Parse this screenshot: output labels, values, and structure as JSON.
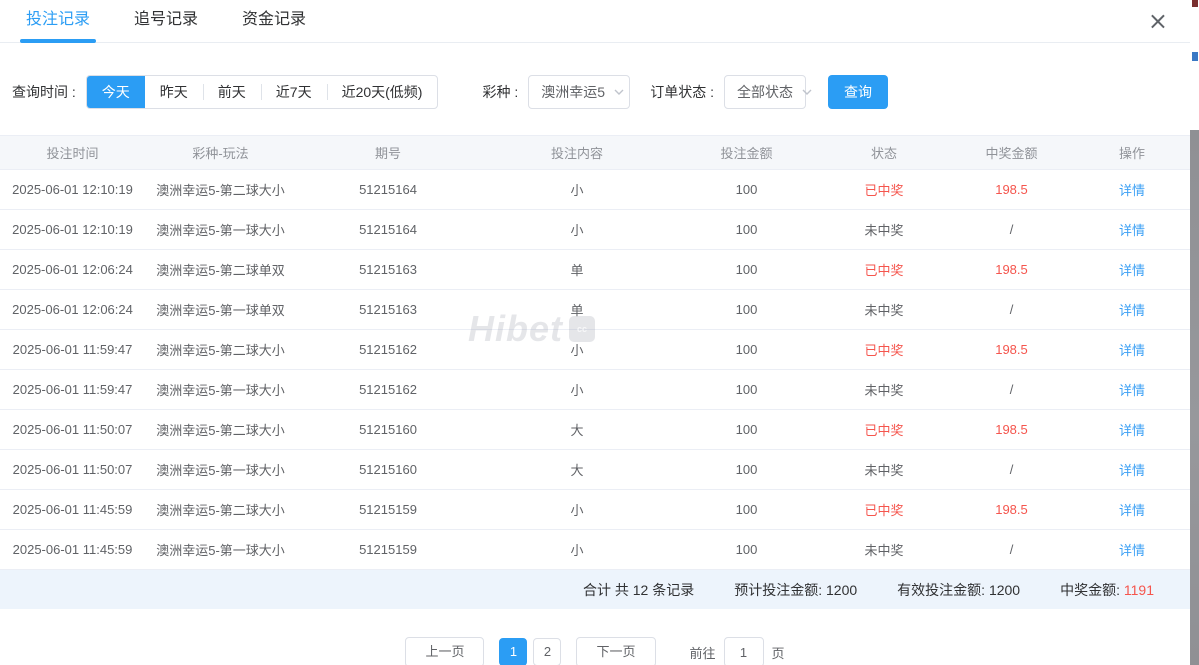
{
  "tabs": {
    "items": [
      {
        "label": "投注记录",
        "active": true
      },
      {
        "label": "追号记录",
        "active": false
      },
      {
        "label": "资金记录",
        "active": false
      }
    ],
    "close_icon": "×"
  },
  "filters": {
    "time_label": "查询时间 :",
    "time_options": [
      "今天",
      "昨天",
      "前天",
      "近7天",
      "近20天(低频)"
    ],
    "time_active": "今天",
    "lottery_label": "彩种 :",
    "lottery_value": "澳洲幸运5",
    "status_label": "订单状态 :",
    "status_value": "全部状态",
    "search_label": "查询"
  },
  "table": {
    "columns": [
      "投注时间",
      "彩种-玩法",
      "期号",
      "投注内容",
      "投注金额",
      "状态",
      "中奖金额",
      "操作"
    ],
    "rows": [
      {
        "time": "2025-06-01 12:10:19",
        "game": "澳洲幸运5-第二球大小",
        "issue": "51215164",
        "content": "小",
        "amount": "100",
        "status": "已中奖",
        "win": "198.5",
        "action": "详情"
      },
      {
        "time": "2025-06-01 12:10:19",
        "game": "澳洲幸运5-第一球大小",
        "issue": "51215164",
        "content": "小",
        "amount": "100",
        "status": "未中奖",
        "win": "/",
        "action": "详情"
      },
      {
        "time": "2025-06-01 12:06:24",
        "game": "澳洲幸运5-第二球单双",
        "issue": "51215163",
        "content": "单",
        "amount": "100",
        "status": "已中奖",
        "win": "198.5",
        "action": "详情"
      },
      {
        "time": "2025-06-01 12:06:24",
        "game": "澳洲幸运5-第一球单双",
        "issue": "51215163",
        "content": "单",
        "amount": "100",
        "status": "未中奖",
        "win": "/",
        "action": "详情"
      },
      {
        "time": "2025-06-01 11:59:47",
        "game": "澳洲幸运5-第二球大小",
        "issue": "51215162",
        "content": "小",
        "amount": "100",
        "status": "已中奖",
        "win": "198.5",
        "action": "详情"
      },
      {
        "time": "2025-06-01 11:59:47",
        "game": "澳洲幸运5-第一球大小",
        "issue": "51215162",
        "content": "小",
        "amount": "100",
        "status": "未中奖",
        "win": "/",
        "action": "详情"
      },
      {
        "time": "2025-06-01 11:50:07",
        "game": "澳洲幸运5-第二球大小",
        "issue": "51215160",
        "content": "大",
        "amount": "100",
        "status": "已中奖",
        "win": "198.5",
        "action": "详情"
      },
      {
        "time": "2025-06-01 11:50:07",
        "game": "澳洲幸运5-第一球大小",
        "issue": "51215160",
        "content": "大",
        "amount": "100",
        "status": "未中奖",
        "win": "/",
        "action": "详情"
      },
      {
        "time": "2025-06-01 11:45:59",
        "game": "澳洲幸运5-第二球大小",
        "issue": "51215159",
        "content": "小",
        "amount": "100",
        "status": "已中奖",
        "win": "198.5",
        "action": "详情"
      },
      {
        "time": "2025-06-01 11:45:59",
        "game": "澳洲幸运5-第一球大小",
        "issue": "51215159",
        "content": "小",
        "amount": "100",
        "status": "未中奖",
        "win": "/",
        "action": "详情"
      }
    ],
    "won_status_text": "已中奖",
    "no_win_placeholder": "/"
  },
  "summary": {
    "total": "合计 共 12 条记录",
    "expected": "预计投注金额: 1200",
    "valid": "有效投注金额: 1200",
    "win_label": "中奖金额: ",
    "win_value": "1191"
  },
  "pagination": {
    "prev": "上一页",
    "pages": [
      "1",
      "2"
    ],
    "active_page": "1",
    "next": "下一页",
    "goto_label": "前往",
    "goto_value": "1",
    "page_suffix": "页"
  },
  "watermark": "Hibet",
  "colors": {
    "primary": "#2b9df4",
    "danger": "#f5554d",
    "link": "#3ba0f5",
    "summary_bg": "#edf4fc",
    "header_bg": "#f5f7fa",
    "border": "#ebeef5"
  }
}
